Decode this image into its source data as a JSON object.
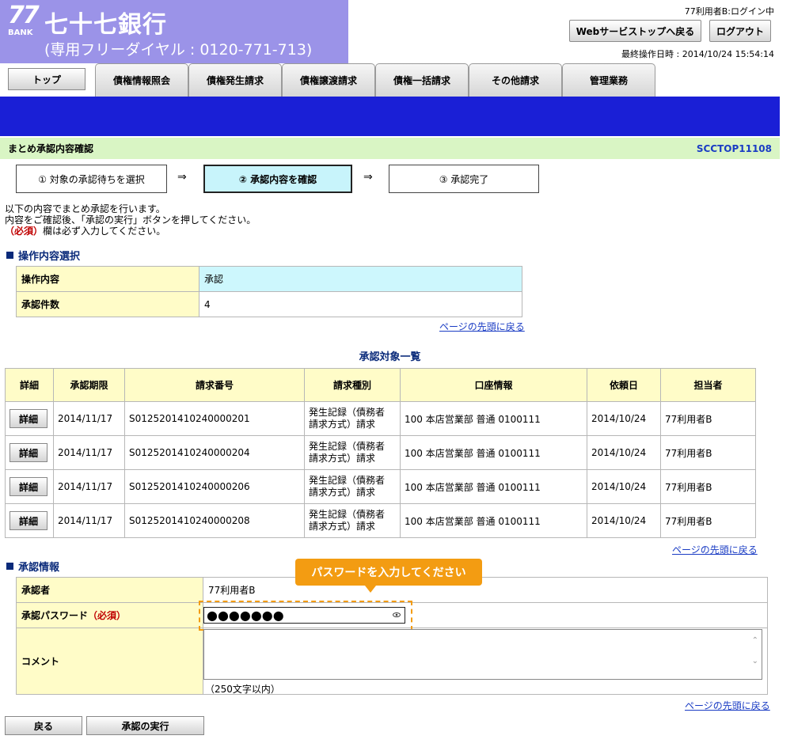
{
  "header": {
    "logo_mark": "77",
    "logo_bank": "BANK",
    "bank_name": "七十七銀行",
    "dial": "(専用フリーダイヤル : 0120-771-713)",
    "login_status": "77利用者B:ログイン中",
    "web_top_label": "Webサービストップへ戻る",
    "logout_label": "ログアウト",
    "last_operation": "最終操作日時 : 2014/10/24 15:54:14"
  },
  "nav": {
    "top_label": "トップ",
    "tabs": [
      "債権情報照会",
      "債権発生請求",
      "債権譲渡請求",
      "債権一括請求",
      "その他請求",
      "管理業務"
    ]
  },
  "page": {
    "title": "まとめ承認内容確認",
    "screen_id": "SCCTOP11108"
  },
  "steps": [
    "① 対象の承認待ちを選択",
    "② 承認内容を確認",
    "③ 承認完了"
  ],
  "step_arrow": "⇒",
  "instructions": {
    "line1": "以下の内容でまとめ承認を行います。",
    "line2": "内容をご確認後、「承認の実行」ボタンを押してください。",
    "req_mark": "（必須）",
    "line3_rest": "欄は必ず入力してください。"
  },
  "op_section": {
    "heading": "操作内容選択",
    "rows": [
      {
        "label": "操作内容",
        "value": "承認"
      },
      {
        "label": "承認件数",
        "value": "4"
      }
    ]
  },
  "page_top_link": "ページの先頭に戻る",
  "list": {
    "title": "承認対象一覧",
    "headers": [
      "詳細",
      "承認期限",
      "請求番号",
      "請求種別",
      "口座情報",
      "依頼日",
      "担当者"
    ],
    "detail_label": "詳細",
    "rows": [
      {
        "deadline": "2014/11/17",
        "number": "S0125201410240000201",
        "kind1": "発生記録（債務者",
        "kind2": "請求方式）請求",
        "account": "100 本店営業部 普通 0100111",
        "date": "2014/10/24",
        "person": "77利用者B"
      },
      {
        "deadline": "2014/11/17",
        "number": "S0125201410240000204",
        "kind1": "発生記録（債務者",
        "kind2": "請求方式）請求",
        "account": "100 本店営業部 普通 0100111",
        "date": "2014/10/24",
        "person": "77利用者B"
      },
      {
        "deadline": "2014/11/17",
        "number": "S0125201410240000206",
        "kind1": "発生記録（債務者",
        "kind2": "請求方式）請求",
        "account": "100 本店営業部 普通 0100111",
        "date": "2014/10/24",
        "person": "77利用者B"
      },
      {
        "deadline": "2014/11/17",
        "number": "S0125201410240000208",
        "kind1": "発生記録（債務者",
        "kind2": "請求方式）請求",
        "account": "100 本店営業部 普通 0100111",
        "date": "2014/10/24",
        "person": "77利用者B"
      }
    ]
  },
  "approval": {
    "heading": "承認情報",
    "approver_label": "承認者",
    "approver_value": "77利用者B",
    "password_label": "承認パスワード",
    "password_req": "（必須）",
    "password_value": "●●●●●●●",
    "comment_label": "コメント",
    "comment_value": "",
    "comment_note": "（250文字以内）",
    "callout": "パスワードを入力してください"
  },
  "buttons": {
    "back": "戻る",
    "execute": "承認の実行"
  },
  "colors": {
    "header_purple": "#9b93e8",
    "nav_blue": "#1a1fd6",
    "title_green": "#d9f5c4",
    "label_yellow": "#fffcc8",
    "highlight_cyan": "#cdf7fd",
    "callout_orange": "#f39c12",
    "link_blue": "#1a3cc4"
  }
}
